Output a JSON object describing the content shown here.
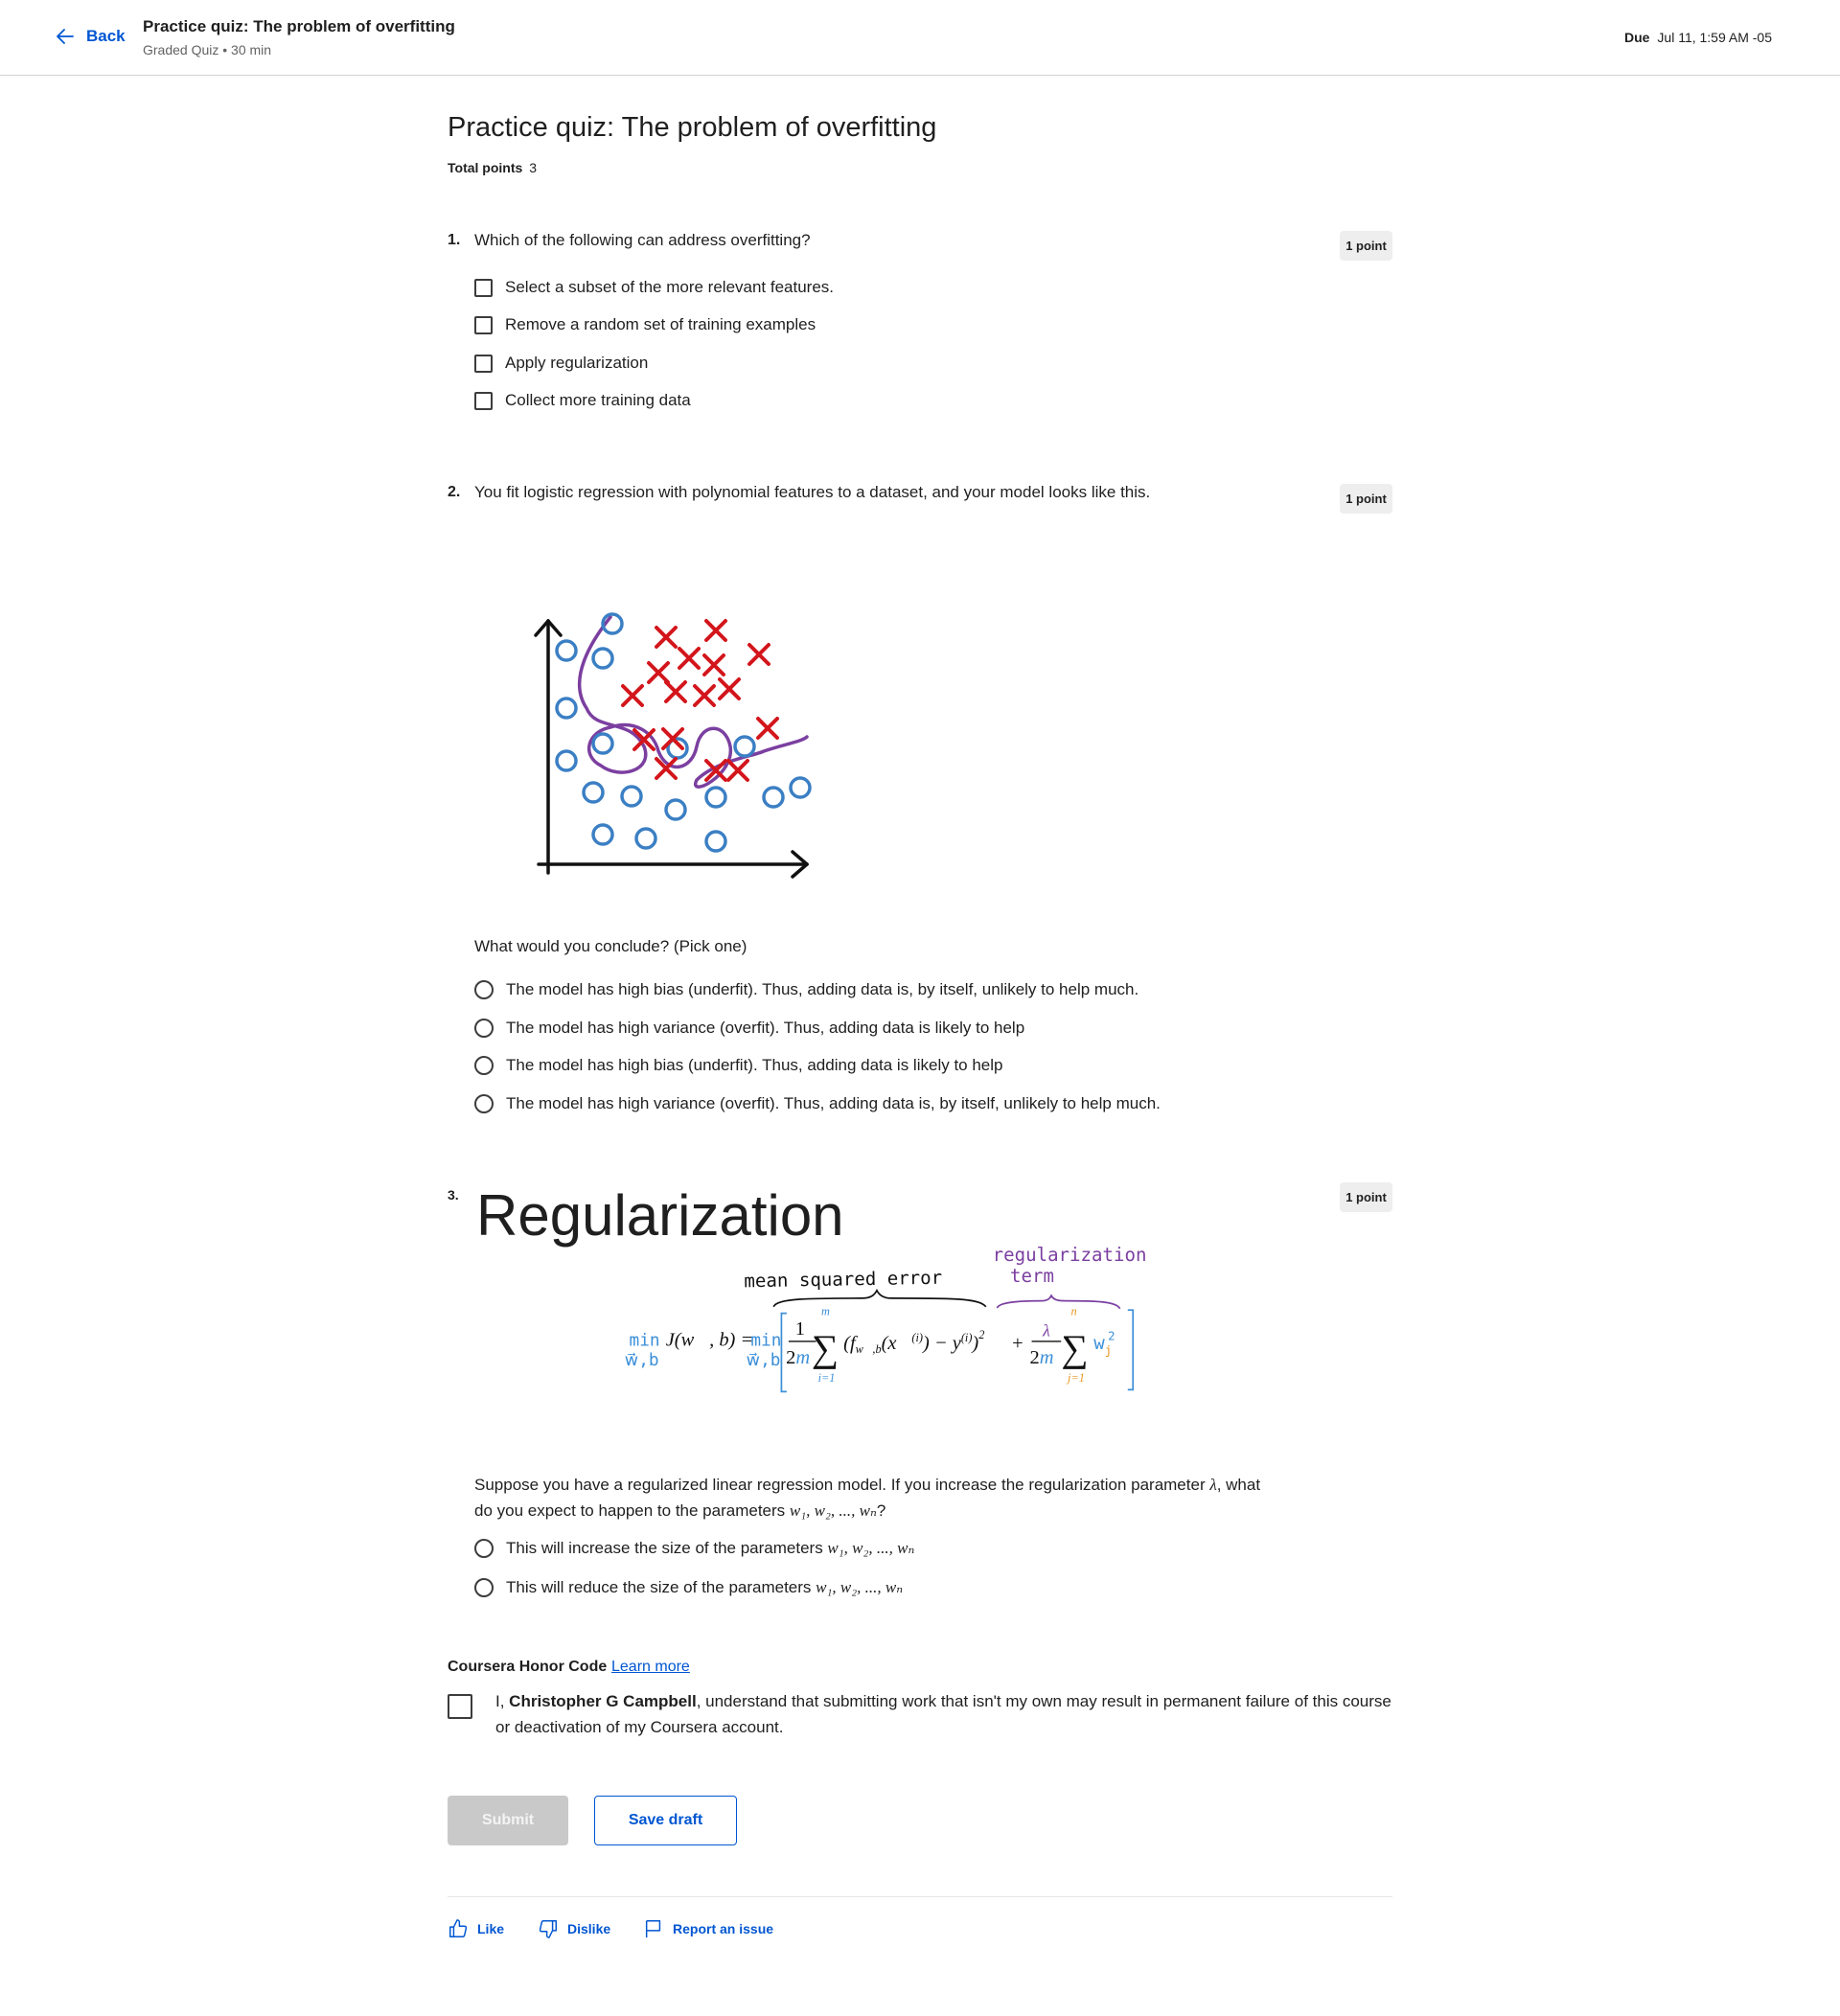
{
  "header": {
    "back_label": "Back",
    "title": "Practice quiz: The problem of overfitting",
    "subtitle": "Graded Quiz • 30 min",
    "due_label": "Due",
    "due_value": "Jul 11, 1:59 AM -05"
  },
  "quiz": {
    "title": "Practice quiz: The problem of overfitting",
    "total_points_label": "Total points",
    "total_points_value": "3"
  },
  "questions": [
    {
      "number": "1.",
      "text": "Which of the following can address overfitting?",
      "points": "1 point",
      "options": [
        "Select a subset of the more relevant features.",
        "Remove a random set of training examples",
        "Apply regularization",
        "Collect more training data"
      ]
    },
    {
      "number": "2.",
      "text": "You fit logistic regression with polynomial features to a dataset, and your model looks like this.",
      "points": "1 point",
      "prompt": "What would you conclude? (Pick one)",
      "options": [
        "The model has high bias (underfit). Thus, adding data is, by itself, unlikely to help much.",
        "The model has high variance (overfit). Thus, adding data is likely to help",
        "The model has high bias (underfit). Thus, adding data is likely to help",
        "The model has high variance (overfit). Thus, adding data is, by itself, unlikely to help much."
      ]
    },
    {
      "number": "3.",
      "points": "1 point",
      "figure_title": "Regularization",
      "figure_labels": {
        "mse": "mean squared error",
        "reg_term_1": "regularization",
        "reg_term_2": "term",
        "min_left": "min",
        "min_sub_left": "w⃗,b",
        "cost": "J(w⃗, b) =",
        "min_right": "min",
        "min_sub_right": "w⃗,b"
      },
      "text_before_lambda": "Suppose you have a regularized linear regression model.  If you increase the regularization parameter ",
      "lambda": "λ",
      "text_after_lambda": ", what do you expect to happen to the parameters ",
      "params": "w₁, w₂, ..., wₙ",
      "qmark": "?",
      "options": [
        {
          "text": "This will increase the size of the parameters ",
          "math": "w₁, w₂, ..., wₙ"
        },
        {
          "text": "This will reduce the size of the parameters ",
          "math": "w₁, w₂, ..., wₙ"
        }
      ]
    }
  ],
  "honor": {
    "heading": "Coursera Honor Code",
    "learn_more": "Learn more",
    "prefix": "I, ",
    "name": "Christopher G Campbell",
    "suffix": ", understand that submitting work that isn't my own may result in permanent failure of this course or deactivation of my Coursera account."
  },
  "actions": {
    "submit": "Submit",
    "save_draft": "Save draft"
  },
  "feedback": {
    "like": "Like",
    "dislike": "Dislike",
    "report": "Report an issue"
  },
  "colors": {
    "accent": "#0056d2",
    "circle": "#3b7fc4",
    "cross": "#d3161c",
    "boundary": "#7b3fa0",
    "orange": "#e8961e"
  },
  "icons": [
    "arrow-left-icon",
    "thumbs-up-icon",
    "thumbs-down-icon",
    "flag-icon"
  ]
}
